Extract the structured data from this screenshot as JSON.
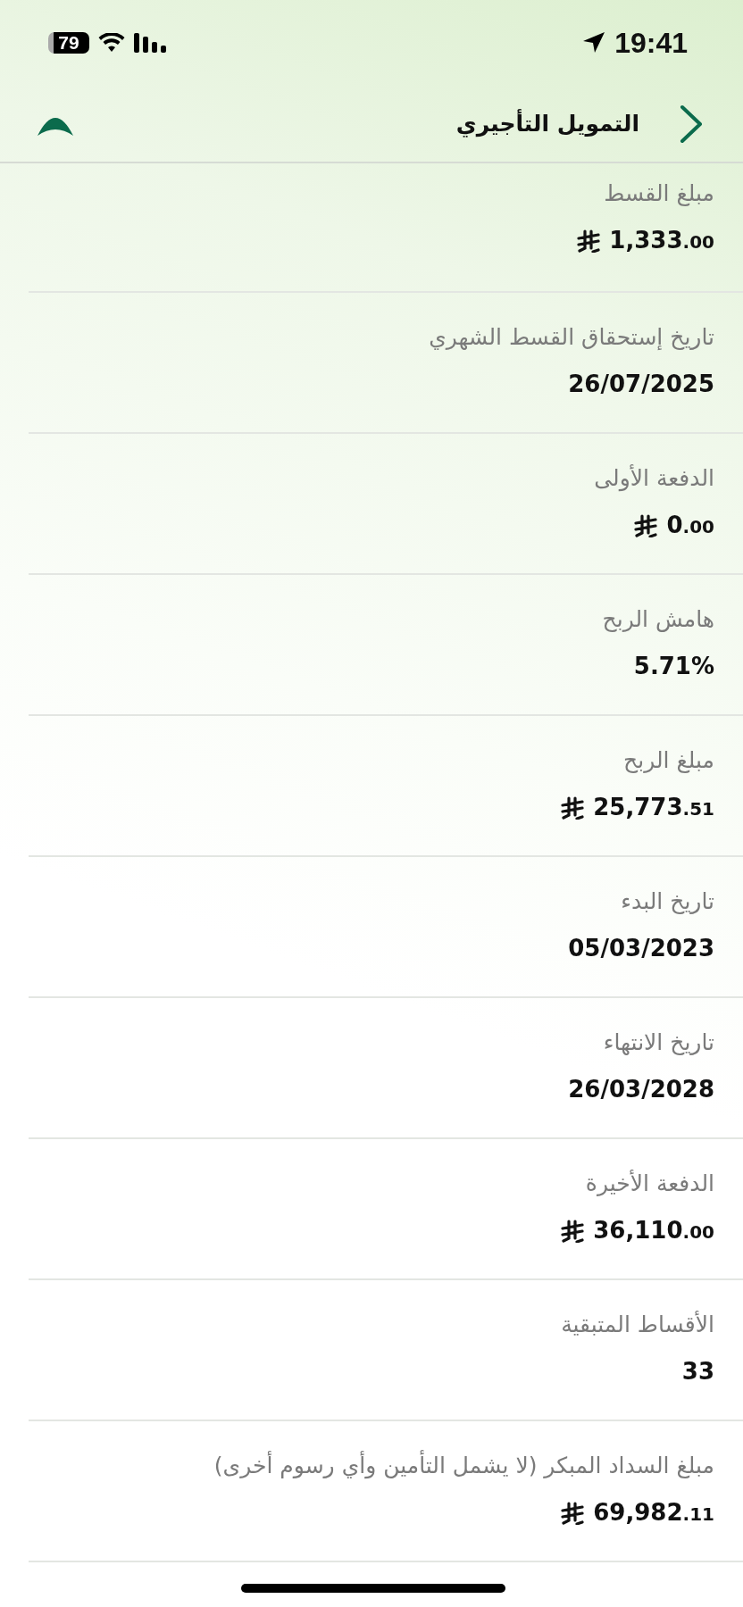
{
  "status_bar": {
    "time": "19:41",
    "battery": "79"
  },
  "header": {
    "title": "التمويل التأجيري"
  },
  "rows": [
    {
      "label": "مبلغ القسط",
      "kind": "currency",
      "amount": "1,333",
      "fraction": ".00"
    },
    {
      "label": "تاريخ إستحقاق القسط الشهري",
      "kind": "plain",
      "value": "26/07/2025"
    },
    {
      "label": "الدفعة الأولى",
      "kind": "currency",
      "amount": "0",
      "fraction": ".00"
    },
    {
      "label": "هامش الربح",
      "kind": "plain",
      "value": "5.71%"
    },
    {
      "label": "مبلغ الربح",
      "kind": "currency",
      "amount": "25,773",
      "fraction": ".51"
    },
    {
      "label": "تاريخ البدء",
      "kind": "plain",
      "value": "05/03/2023"
    },
    {
      "label": "تاريخ الانتهاء",
      "kind": "plain",
      "value": "26/03/2028"
    },
    {
      "label": "الدفعة الأخيرة",
      "kind": "currency",
      "amount": "36,110",
      "fraction": ".00"
    },
    {
      "label": "الأقساط المتبقية",
      "kind": "plain",
      "value": "33"
    },
    {
      "label": "مبلغ السداد المبكر (لا يشمل التأمين وأي رسوم أخرى)",
      "kind": "currency",
      "amount": "69,982",
      "fraction": ".11"
    }
  ]
}
